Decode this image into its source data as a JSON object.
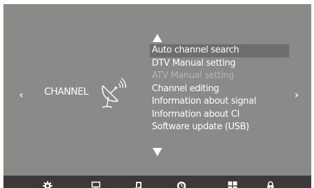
{
  "menu": {
    "category_title": "CHANNEL",
    "items": [
      {
        "label": "Auto channel search",
        "state": "selected"
      },
      {
        "label": "DTV Manual setting",
        "state": "normal"
      },
      {
        "label": "ATV Manual setting",
        "state": "disabled"
      },
      {
        "label": "Channel editing",
        "state": "normal"
      },
      {
        "label": "Information about signal",
        "state": "normal"
      },
      {
        "label": "Information about CI",
        "state": "normal"
      },
      {
        "label": "Software update (USB)",
        "state": "normal"
      }
    ]
  },
  "navigation": {
    "prev_symbol": "‹",
    "next_symbol": "›"
  },
  "icons": {
    "category": "satellite-dish-icon",
    "scroll_up": "triangle-up-icon",
    "scroll_down": "triangle-down-icon",
    "bottom_tabs": [
      "gear-icon",
      "monitor-icon",
      "music-note-icon",
      "clock-icon",
      "grid-icon",
      "lock-icon"
    ]
  },
  "colors": {
    "panel_background": "#8a8a88",
    "selected_row": "#6e6e6d",
    "bottom_bar": "#3a3a39",
    "text": "#ffffff",
    "disabled_text": "#b3b3b1"
  }
}
